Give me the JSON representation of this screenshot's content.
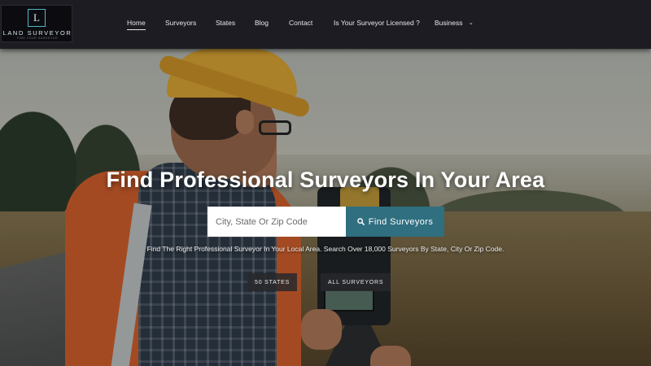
{
  "logo": {
    "letter": "L",
    "name": "LAND SURVEYOR",
    "tagline": "FIND YOUR SURVEYOR"
  },
  "nav": {
    "items": [
      {
        "label": "Home",
        "active": true
      },
      {
        "label": "Surveyors"
      },
      {
        "label": "States"
      },
      {
        "label": "Blog"
      },
      {
        "label": "Contact"
      },
      {
        "label": "Is Your Surveyor Licensed ?"
      },
      {
        "label": "Business",
        "dropdown": true
      }
    ]
  },
  "hero": {
    "title": "Find Professional Surveyors In Your Area",
    "search_placeholder": "City, State Or Zip Code",
    "search_button": "Find Surveyors",
    "subtitle": "Find The Right Professional Surveyor In Your Local Area. Search Over 18,000 Surveyors By State, City Or Zip Code.",
    "buttons": {
      "states": "50 STATES",
      "all": "ALL SURVEYORS"
    }
  },
  "colors": {
    "header_bg": "#1c1c22",
    "accent": "#2f6f80",
    "logo_accent": "#4fb8c8"
  },
  "icons": {
    "search": "search-icon",
    "chevron": "chevron-down-icon"
  }
}
